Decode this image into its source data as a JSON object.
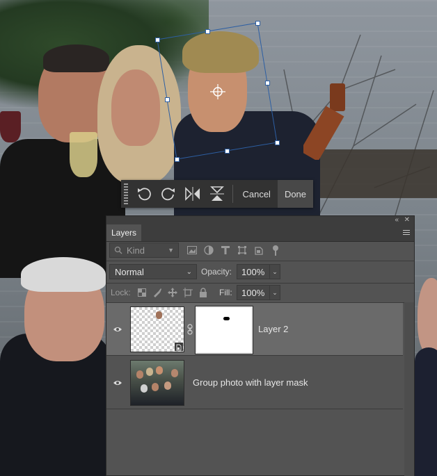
{
  "toolbar": {
    "icons": [
      "rotate-left-icon",
      "rotate-right-icon",
      "flip-horizontal-icon",
      "flip-vertical-icon"
    ],
    "cancel_label": "Cancel",
    "done_label": "Done"
  },
  "layers_panel": {
    "tab_label": "Layers",
    "filter": {
      "kind_label": "Kind"
    },
    "blend_mode": "Normal",
    "opacity_label": "Opacity:",
    "opacity_value": "100%",
    "lock_label": "Lock:",
    "fill_label": "Fill:",
    "fill_value": "100%",
    "layers": [
      {
        "name": "Layer 2",
        "selected": true,
        "visible": true,
        "has_mask": true
      },
      {
        "name": "Group photo with layer mask",
        "selected": false,
        "visible": true,
        "has_mask": false
      }
    ]
  },
  "colors": {
    "panel_bg": "#535353",
    "panel_header": "#3d3d3d",
    "selected_row": "#6a6a6a",
    "transform_outline": "#2d5fa3",
    "toolbar_bg": "#323232"
  }
}
